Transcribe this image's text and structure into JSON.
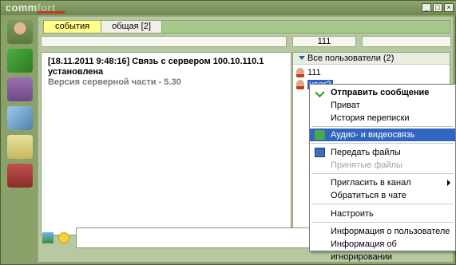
{
  "app": {
    "logo_part1": "comm",
    "logo_part2": "fort",
    "window_buttons": [
      "_",
      "□",
      "×"
    ]
  },
  "tabs": [
    {
      "label": "события",
      "active": true
    },
    {
      "label": "общая [2]",
      "active": false
    }
  ],
  "toolbar": {
    "counter": "111"
  },
  "chat": {
    "line1": "[18.11.2011 9:48:16] Связь с сервером 100.10.110.1 установлена",
    "line2": "Версия серверной части - 5.30"
  },
  "users": {
    "header": "Все пользователи (2)",
    "items": [
      {
        "name": "111",
        "selected": false
      },
      {
        "name": "user2",
        "selected": true
      }
    ]
  },
  "context_menu": {
    "items": [
      {
        "label": "Отправить сообщение",
        "bold": true,
        "icon": "check-icon"
      },
      {
        "label": "Приват"
      },
      {
        "label": "История переписки"
      },
      {
        "label": "Аудио- и видеосвязь",
        "highlighted": true,
        "icon": "av-icon"
      },
      {
        "label": "Передать файлы",
        "icon": "monitor-icon"
      },
      {
        "label": "Принятые файлы",
        "disabled": true
      },
      {
        "label": "Пригласить в канал",
        "submenu": true
      },
      {
        "label": "Обратиться в чате"
      },
      {
        "label": "Настроить"
      },
      {
        "label": "Информация о пользователе"
      },
      {
        "label": "Информация об игнорировании"
      }
    ]
  },
  "colors": {
    "accent": "#3166c0",
    "active_tab": "#ffff8a",
    "chrome": "#8aa26a"
  }
}
